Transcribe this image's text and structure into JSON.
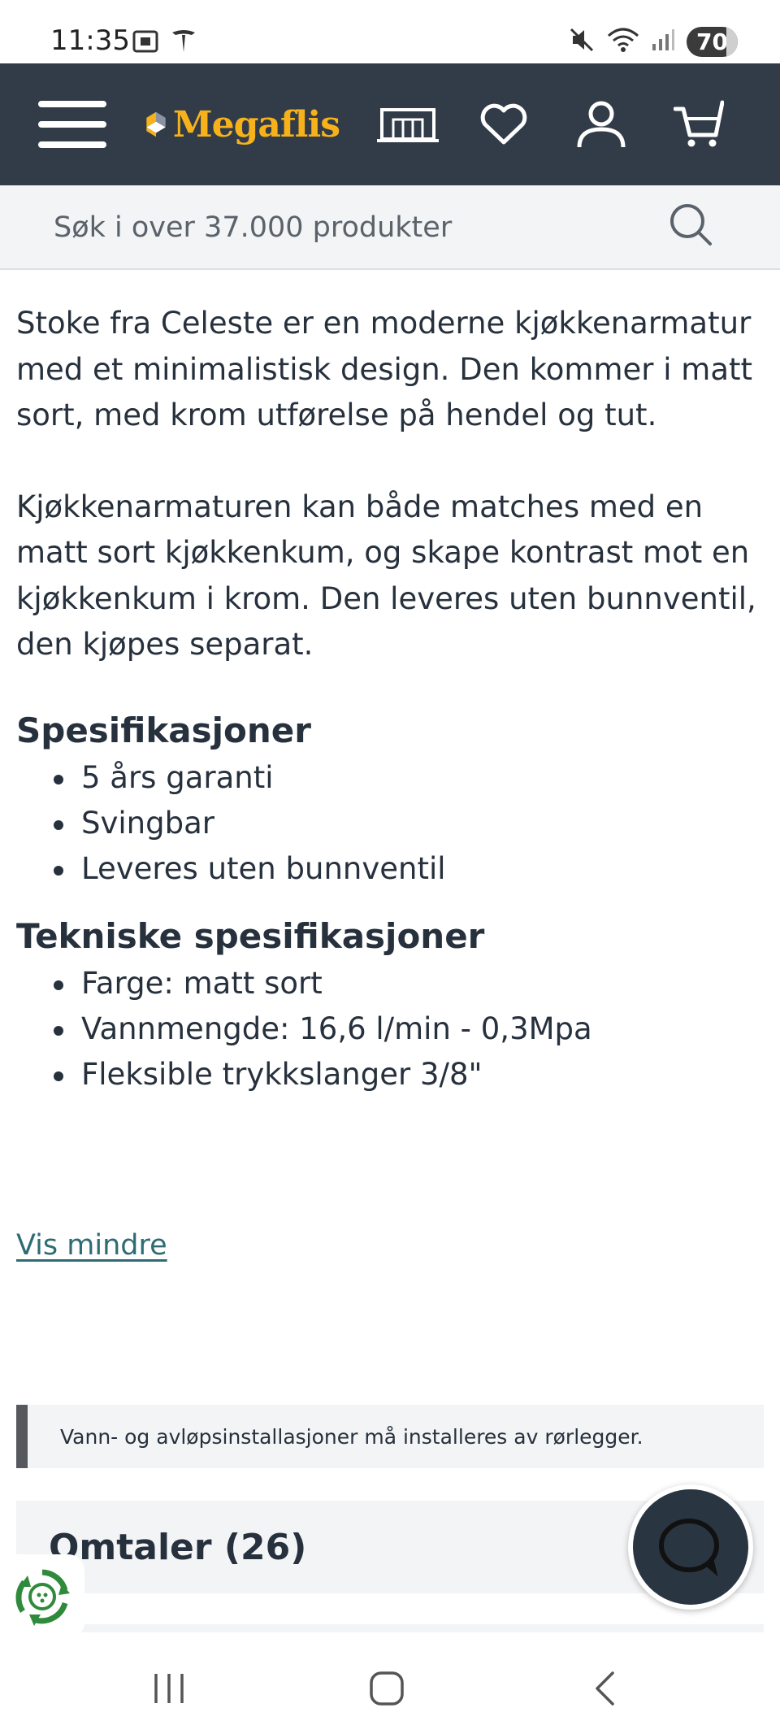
{
  "status_bar": {
    "time": "11:35",
    "battery": "70",
    "icons": [
      "screenshot-icon",
      "tesla-icon",
      "mute-icon",
      "wifi-icon",
      "signal-icon"
    ]
  },
  "header": {
    "logo_text": "Megaflis",
    "icons": [
      "menu-icon",
      "showroom-icon",
      "heart-icon",
      "user-icon",
      "cart-icon"
    ],
    "bg_color": "#323c48",
    "brand_color": "#f7b21b"
  },
  "search": {
    "placeholder": "Søk i over 37.000 produkter"
  },
  "description": {
    "paragraphs": [
      "Stoke fra Celeste er en moderne kjøkkenarmatur med et minimalistisk design. Den kommer i matt sort, med krom utførelse på hendel og tut.",
      "Kjøkkenarmaturen kan både matches med en matt sort kjøkkenkum, og skape kontrast mot en kjøkkenkum i krom. Den leveres uten bunnventil, den kjøpes separat."
    ]
  },
  "specs": {
    "title": "Spesifikasjoner",
    "items": [
      "5 års garanti",
      "Svingbar",
      "Leveres uten bunnventil"
    ]
  },
  "tech_specs": {
    "title": "Tekniske spesifikasjoner",
    "items": [
      "Farge: matt sort",
      "Vannmengde: 16,6 l/min - 0,3Mpa",
      "Fleksible trykkslanger 3/8\""
    ]
  },
  "show_less_label": "Vis mindre",
  "notice": "Vann- og avløpsinstallasjoner må installeres av rørlegger.",
  "reviews": {
    "label": "Omtaler (26)"
  },
  "bottom_nav": [
    "recent-apps-icon",
    "home-icon",
    "back-icon"
  ],
  "link_color": "#2e6c74"
}
